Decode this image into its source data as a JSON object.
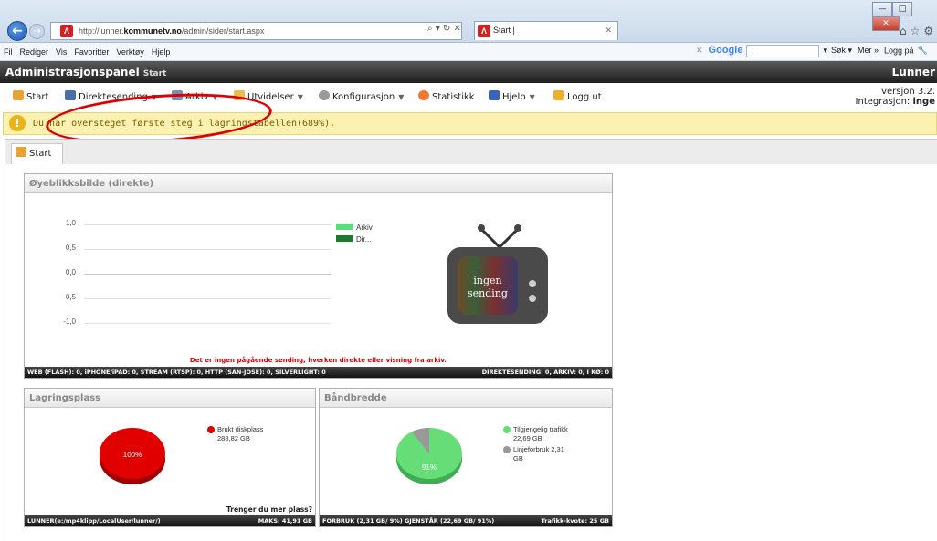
{
  "browser": {
    "url_prefix": "http://lunner.",
    "url_domain": "kommunetv.no",
    "url_path": "/admin/sider/start.aspx",
    "url_controls": "⌕ ▾ ↻ ✕",
    "tab_title": "Start |",
    "menu": [
      "Fil",
      "Rediger",
      "Vis",
      "Favoritter",
      "Verktøy",
      "Hjelp"
    ],
    "search_engine": "Google",
    "right_menu": [
      "Søk ▾",
      "Mer »",
      "Logg på"
    ]
  },
  "header": {
    "title": "Administrasjonspanel",
    "subtitle": "Start",
    "site": "Lunner"
  },
  "nav": {
    "items": [
      {
        "label": "Start",
        "icon": "home-icon",
        "dropdown": false
      },
      {
        "label": "Direktesending",
        "icon": "monitor-icon",
        "dropdown": true
      },
      {
        "label": "Arkiv",
        "icon": "archive-icon",
        "dropdown": true
      },
      {
        "label": "Utvidelser",
        "icon": "extensions-icon",
        "dropdown": true
      },
      {
        "label": "Konfigurasjon",
        "icon": "gear-icon",
        "dropdown": true
      },
      {
        "label": "Statistikk",
        "icon": "stats-icon",
        "dropdown": false
      },
      {
        "label": "Hjelp",
        "icon": "help-book-icon",
        "dropdown": true
      },
      {
        "label": "Logg ut",
        "icon": "lock-icon",
        "dropdown": false
      }
    ],
    "version_label": "versjon 3.2.",
    "integration_label": "Integrasjon:",
    "integration_value": "inge"
  },
  "warning": {
    "text": "Du har oversteget første steg i lagringstabellen(689%)."
  },
  "page_tab": {
    "label": "Start"
  },
  "snapshot": {
    "title": "Øyeblikksbilde (direkte)",
    "ticks": [
      "1,0",
      "0,5",
      "0,0",
      "-0,5",
      "-1,0"
    ],
    "legend": [
      {
        "name": "Arkiv",
        "color": "#5fdc7a"
      },
      {
        "name": "Dir...",
        "color": "#1e7a30"
      }
    ],
    "tv_text_line1": "ingen",
    "tv_text_line2": "sending",
    "notice": "Det er ingen pågående sending, hverken direkte eller visning fra arkiv.",
    "footer_left": "WEB (FLASH): 0, iPHONE/iPAD: 0, STREAM (RTSP): 0, HTTP (SAN-JOSE): 0, SILVERLIGHT: 0",
    "footer_right": "DIREKTESENDING: 0, ARKIV: 0, I KØ: 0"
  },
  "storage": {
    "title": "Lagringsplass",
    "pie_label": "100%",
    "legend_name": "Brukt diskplass",
    "legend_value": "288,82 GB",
    "link": "Trenger du mer plass?",
    "footer_left": "LUNNER(e:/mp4klipp/LocalUser/lunner/)",
    "footer_right": "MAKS: 41,91 GB",
    "used_fraction": 1.0,
    "color": "#e00000"
  },
  "bandwidth": {
    "title": "Båndbredde",
    "pie_label": "91%",
    "legend": [
      {
        "name": "Tilgjengelig trafikk",
        "value": "22,69 GB",
        "color": "#66dd77"
      },
      {
        "name": "Linjeforbruk 2,31",
        "value": "GB",
        "color": "#999999"
      }
    ],
    "available_fraction": 0.91,
    "footer_left": "FORBRUK (2,31 GB/ 9%) GJENSTÅR (22,69 GB/ 91%)",
    "footer_right": "Trafikk-kvote: 25 GB"
  }
}
